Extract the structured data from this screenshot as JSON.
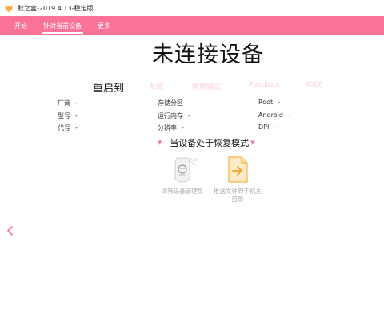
{
  "window": {
    "title": "秋之盒-2019.4.13-稳定版"
  },
  "nav": {
    "tabs": [
      {
        "label": "开始"
      },
      {
        "label": "针对当前设备"
      },
      {
        "label": "更多"
      }
    ]
  },
  "main": {
    "title": "未连接设备"
  },
  "reboot": {
    "label": "重启到",
    "options": [
      "系统",
      "恢复模式",
      "Fastboot",
      "9008"
    ]
  },
  "device_info": {
    "left": [
      {
        "label": "厂商",
        "value": "-"
      },
      {
        "label": "型号",
        "value": "-"
      },
      {
        "label": "代号",
        "value": "-"
      }
    ],
    "middle": [
      {
        "label": "存储分区",
        "value": ""
      },
      {
        "label": "运行内存",
        "value": "-"
      },
      {
        "label": "分辨率",
        "value": "-"
      }
    ],
    "right": [
      {
        "label": "Root",
        "value": "-"
      },
      {
        "label": "Android",
        "value": "-"
      },
      {
        "label": "DPI",
        "value": "-"
      }
    ]
  },
  "recovery": {
    "title": "当设备处于恢复模式",
    "tools": [
      {
        "label": "清除设备管理员",
        "icon": "robot-clear-icon"
      },
      {
        "label": "推送文件到手机主目录",
        "icon": "push-file-icon"
      }
    ]
  },
  "icons": {
    "app": "fox-app-icon",
    "back": "back-arrow-icon"
  },
  "colors": {
    "accent": "#fb7299",
    "muted_option": "#fbd0de",
    "disabled_text": "#aaaaaa"
  }
}
